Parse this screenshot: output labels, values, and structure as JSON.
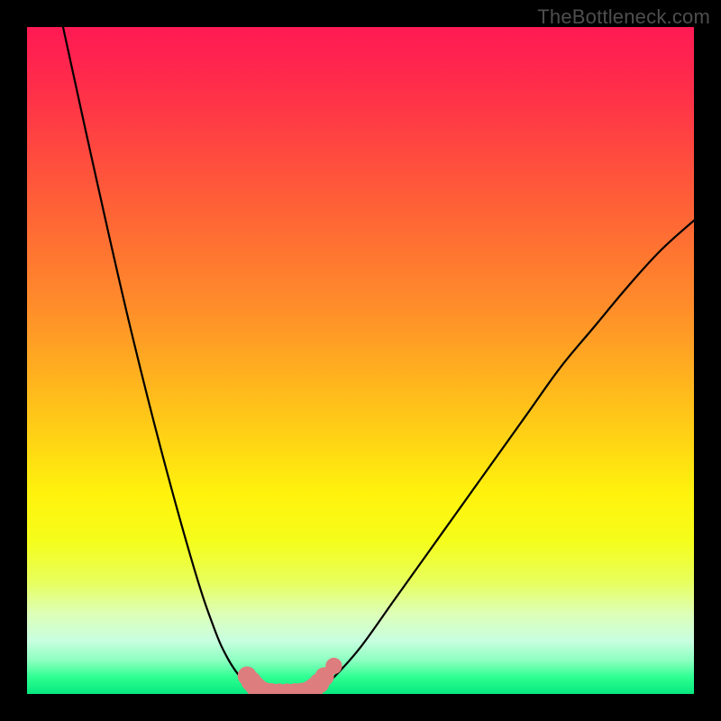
{
  "watermark": "TheBottleneck.com",
  "colors": {
    "frame": "#000000",
    "curve": "#000000",
    "marker_fill": "#de7d7e",
    "marker_stroke": "#de7d7e"
  },
  "chart_data": {
    "type": "line",
    "title": "",
    "xlabel": "",
    "ylabel": "",
    "xlim": [
      0,
      100
    ],
    "ylim": [
      0,
      100
    ],
    "grid": false,
    "legend": false,
    "annotations": [
      "TheBottleneck.com"
    ],
    "series": [
      {
        "name": "left-curve",
        "x": [
          5.4,
          10,
          15,
          20,
          25,
          28,
          30,
          32,
          33.5,
          34.5,
          35.5
        ],
        "y": [
          100,
          79,
          57,
          37,
          19,
          10,
          5.5,
          2.5,
          1.3,
          0.6,
          0.2
        ]
      },
      {
        "name": "valley-floor",
        "x": [
          35.5,
          37,
          39,
          41,
          42.5
        ],
        "y": [
          0.2,
          0.08,
          0.05,
          0.08,
          0.2
        ]
      },
      {
        "name": "right-curve",
        "x": [
          42.5,
          44,
          46,
          50,
          55,
          60,
          65,
          70,
          75,
          80,
          85,
          90,
          95,
          100
        ],
        "y": [
          0.2,
          0.9,
          2.5,
          7,
          14,
          21,
          28,
          35,
          42,
          49,
          55,
          61,
          66.5,
          71
        ]
      }
    ],
    "markers": [
      {
        "x": 33.0,
        "y": 2.7,
        "r": 1.5
      },
      {
        "x": 33.6,
        "y": 1.9,
        "r": 1.6
      },
      {
        "x": 34.2,
        "y": 1.2,
        "r": 1.6
      },
      {
        "x": 34.9,
        "y": 0.6,
        "r": 1.6
      },
      {
        "x": 35.6,
        "y": 0.25,
        "r": 1.6
      },
      {
        "x": 36.6,
        "y": 0.1,
        "r": 1.6
      },
      {
        "x": 37.8,
        "y": 0.05,
        "r": 1.6
      },
      {
        "x": 39.0,
        "y": 0.05,
        "r": 1.6
      },
      {
        "x": 40.2,
        "y": 0.08,
        "r": 1.6
      },
      {
        "x": 41.2,
        "y": 0.15,
        "r": 1.6
      },
      {
        "x": 42.2,
        "y": 0.4,
        "r": 1.6
      },
      {
        "x": 43.0,
        "y": 0.9,
        "r": 1.6
      },
      {
        "x": 43.8,
        "y": 1.6,
        "r": 1.6
      },
      {
        "x": 44.6,
        "y": 2.6,
        "r": 1.5
      },
      {
        "x": 46.0,
        "y": 4.2,
        "r": 1.3
      }
    ]
  }
}
